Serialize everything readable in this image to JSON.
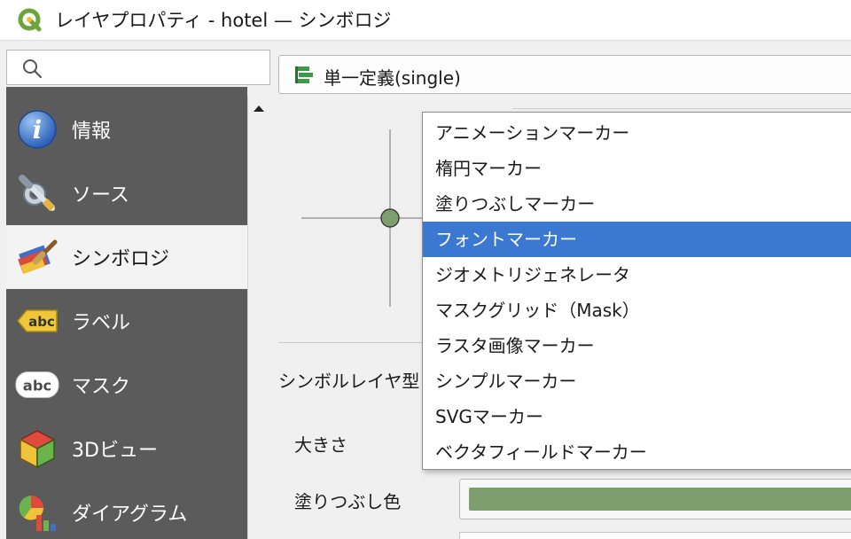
{
  "window": {
    "title": "レイヤプロパティ - hotel — シンボロジ",
    "accent": "#3a78d1"
  },
  "search": {
    "value": "",
    "placeholder": ""
  },
  "sidebar": {
    "items": [
      {
        "label": "情報",
        "icon": "info-icon"
      },
      {
        "label": "ソース",
        "icon": "source-icon"
      },
      {
        "label": "シンボロジ",
        "icon": "symbology-icon",
        "selected": true
      },
      {
        "label": "ラベル",
        "icon": "label-icon"
      },
      {
        "label": "マスク",
        "icon": "mask-icon"
      },
      {
        "label": "3Dビュー",
        "icon": "3d-view-icon"
      },
      {
        "label": "ダイアグラム",
        "icon": "diagram-icon"
      }
    ]
  },
  "renderer": {
    "label": "単一定義(single)",
    "icon": "single-symbol-icon"
  },
  "form": {
    "symbol_layer_type_label": "シンボルレイヤ型",
    "size_label": "大きさ",
    "fill_color_label": "塗りつぶし色",
    "fill_color": "#7f9e6e"
  },
  "dropdown": {
    "items": [
      "アニメーションマーカー",
      "楕円マーカー",
      "塗りつぶしマーカー",
      "フォントマーカー",
      "ジオメトリジェネレータ",
      "マスクグリッド（Mask）",
      "ラスタ画像マーカー",
      "シンプルマーカー",
      "SVGマーカー",
      "ベクタフィールドマーカー"
    ],
    "highlighted_index": 3
  }
}
